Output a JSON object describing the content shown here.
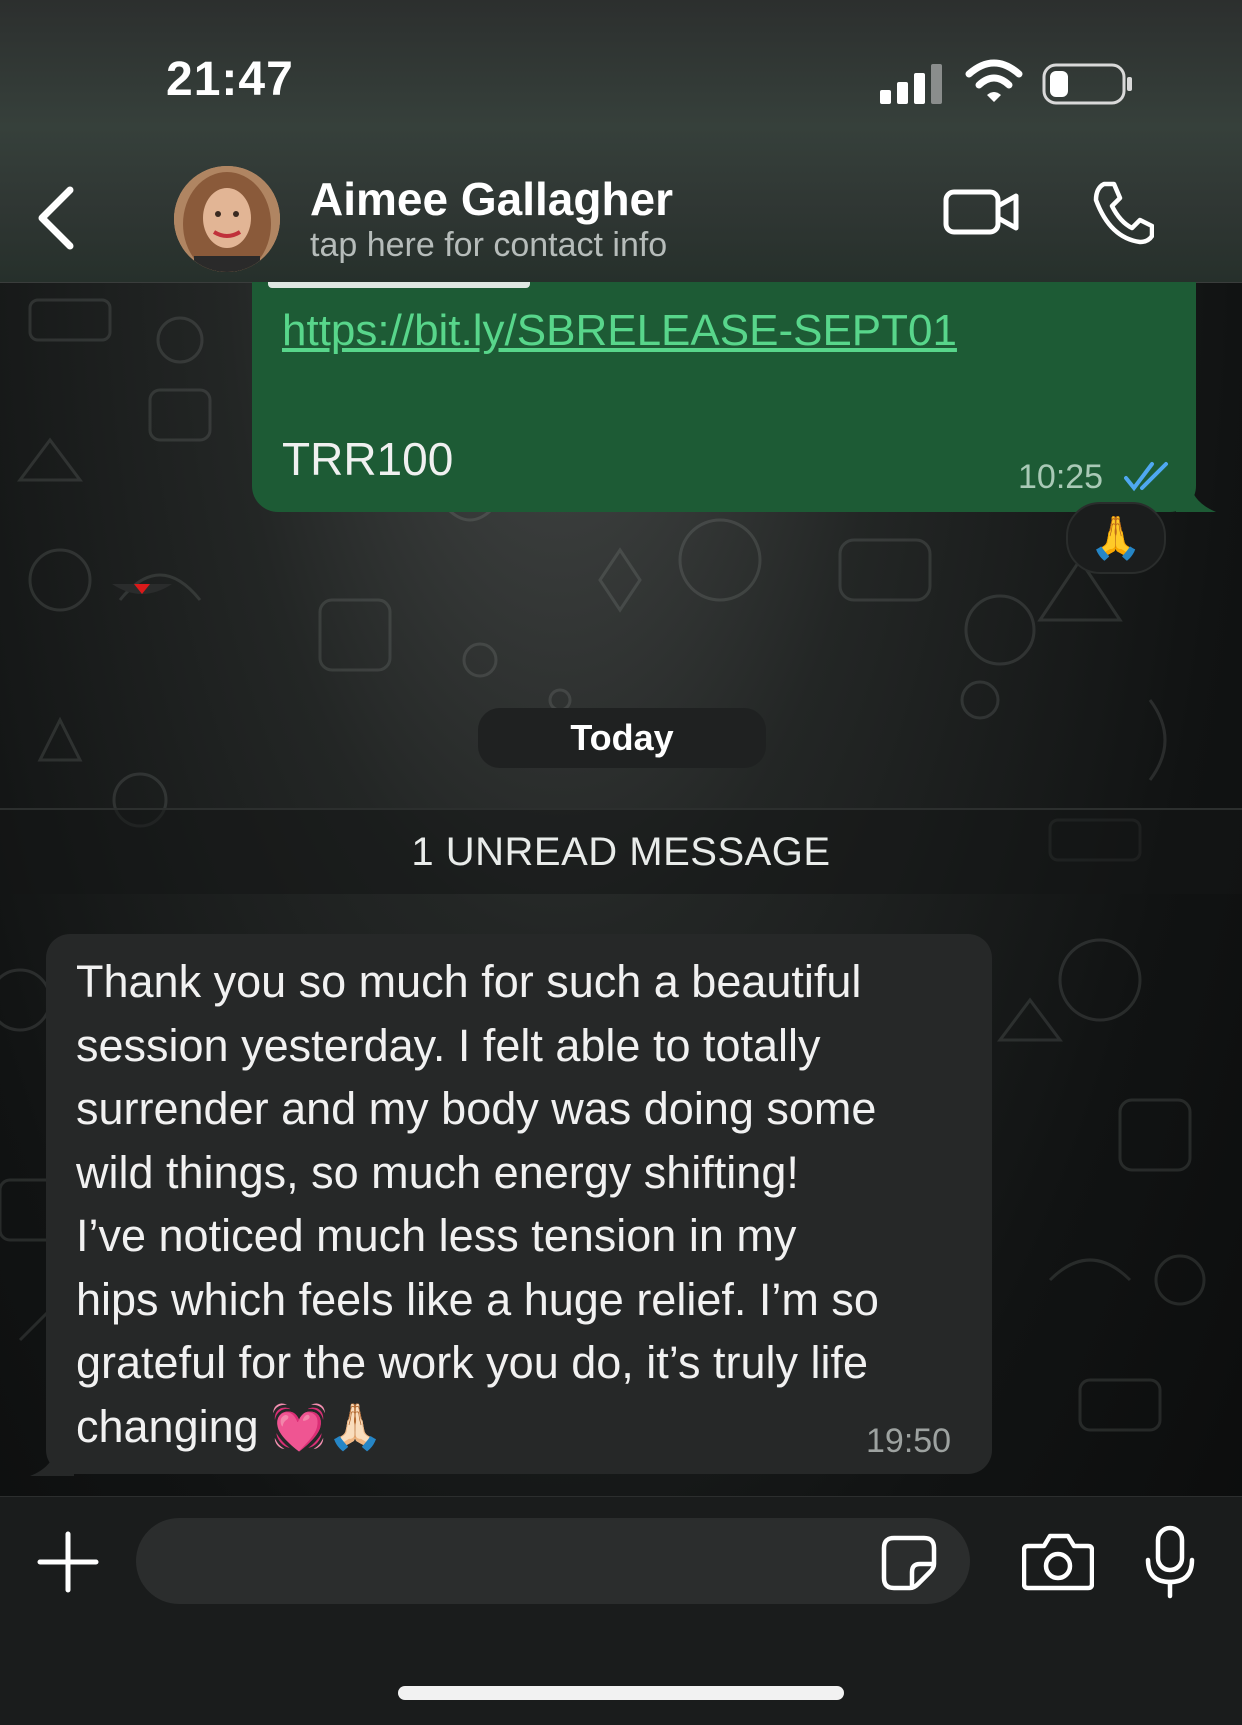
{
  "status_bar": {
    "time": "21:47"
  },
  "header": {
    "contact_name": "Aimee Gallagher",
    "subtitle": "tap here for contact info",
    "icons": [
      "back-chevron",
      "video-camera",
      "phone"
    ]
  },
  "messages": {
    "outgoing": {
      "link": "https://bit.ly/SBRELEASE-SEPT01",
      "code": "TRR100",
      "time": "10:25",
      "status": "read",
      "reaction": "🙏"
    },
    "date_separator": "Today",
    "unread_banner": "1 UNREAD MESSAGE",
    "incoming": {
      "lines": [
        "Thank you so much for such a beautiful",
        "session yesterday. I felt able to totally",
        "surrender and my body was doing some",
        "wild things, so much energy shifting!",
        "I’ve noticed much less tension in my",
        "hips which feels like a huge relief. I’m so",
        "grateful for the work you do, it’s truly life",
        "changing 💓🙏🏻"
      ],
      "time": "19:50"
    }
  },
  "composer": {
    "placeholder": "",
    "icons": [
      "plus",
      "sticker",
      "camera",
      "microphone"
    ]
  },
  "colors": {
    "outgoing_bubble": "#1d5b35",
    "incoming_bubble": "#262828",
    "link": "#58d68b",
    "read_ticks": "#4fa8f0"
  }
}
